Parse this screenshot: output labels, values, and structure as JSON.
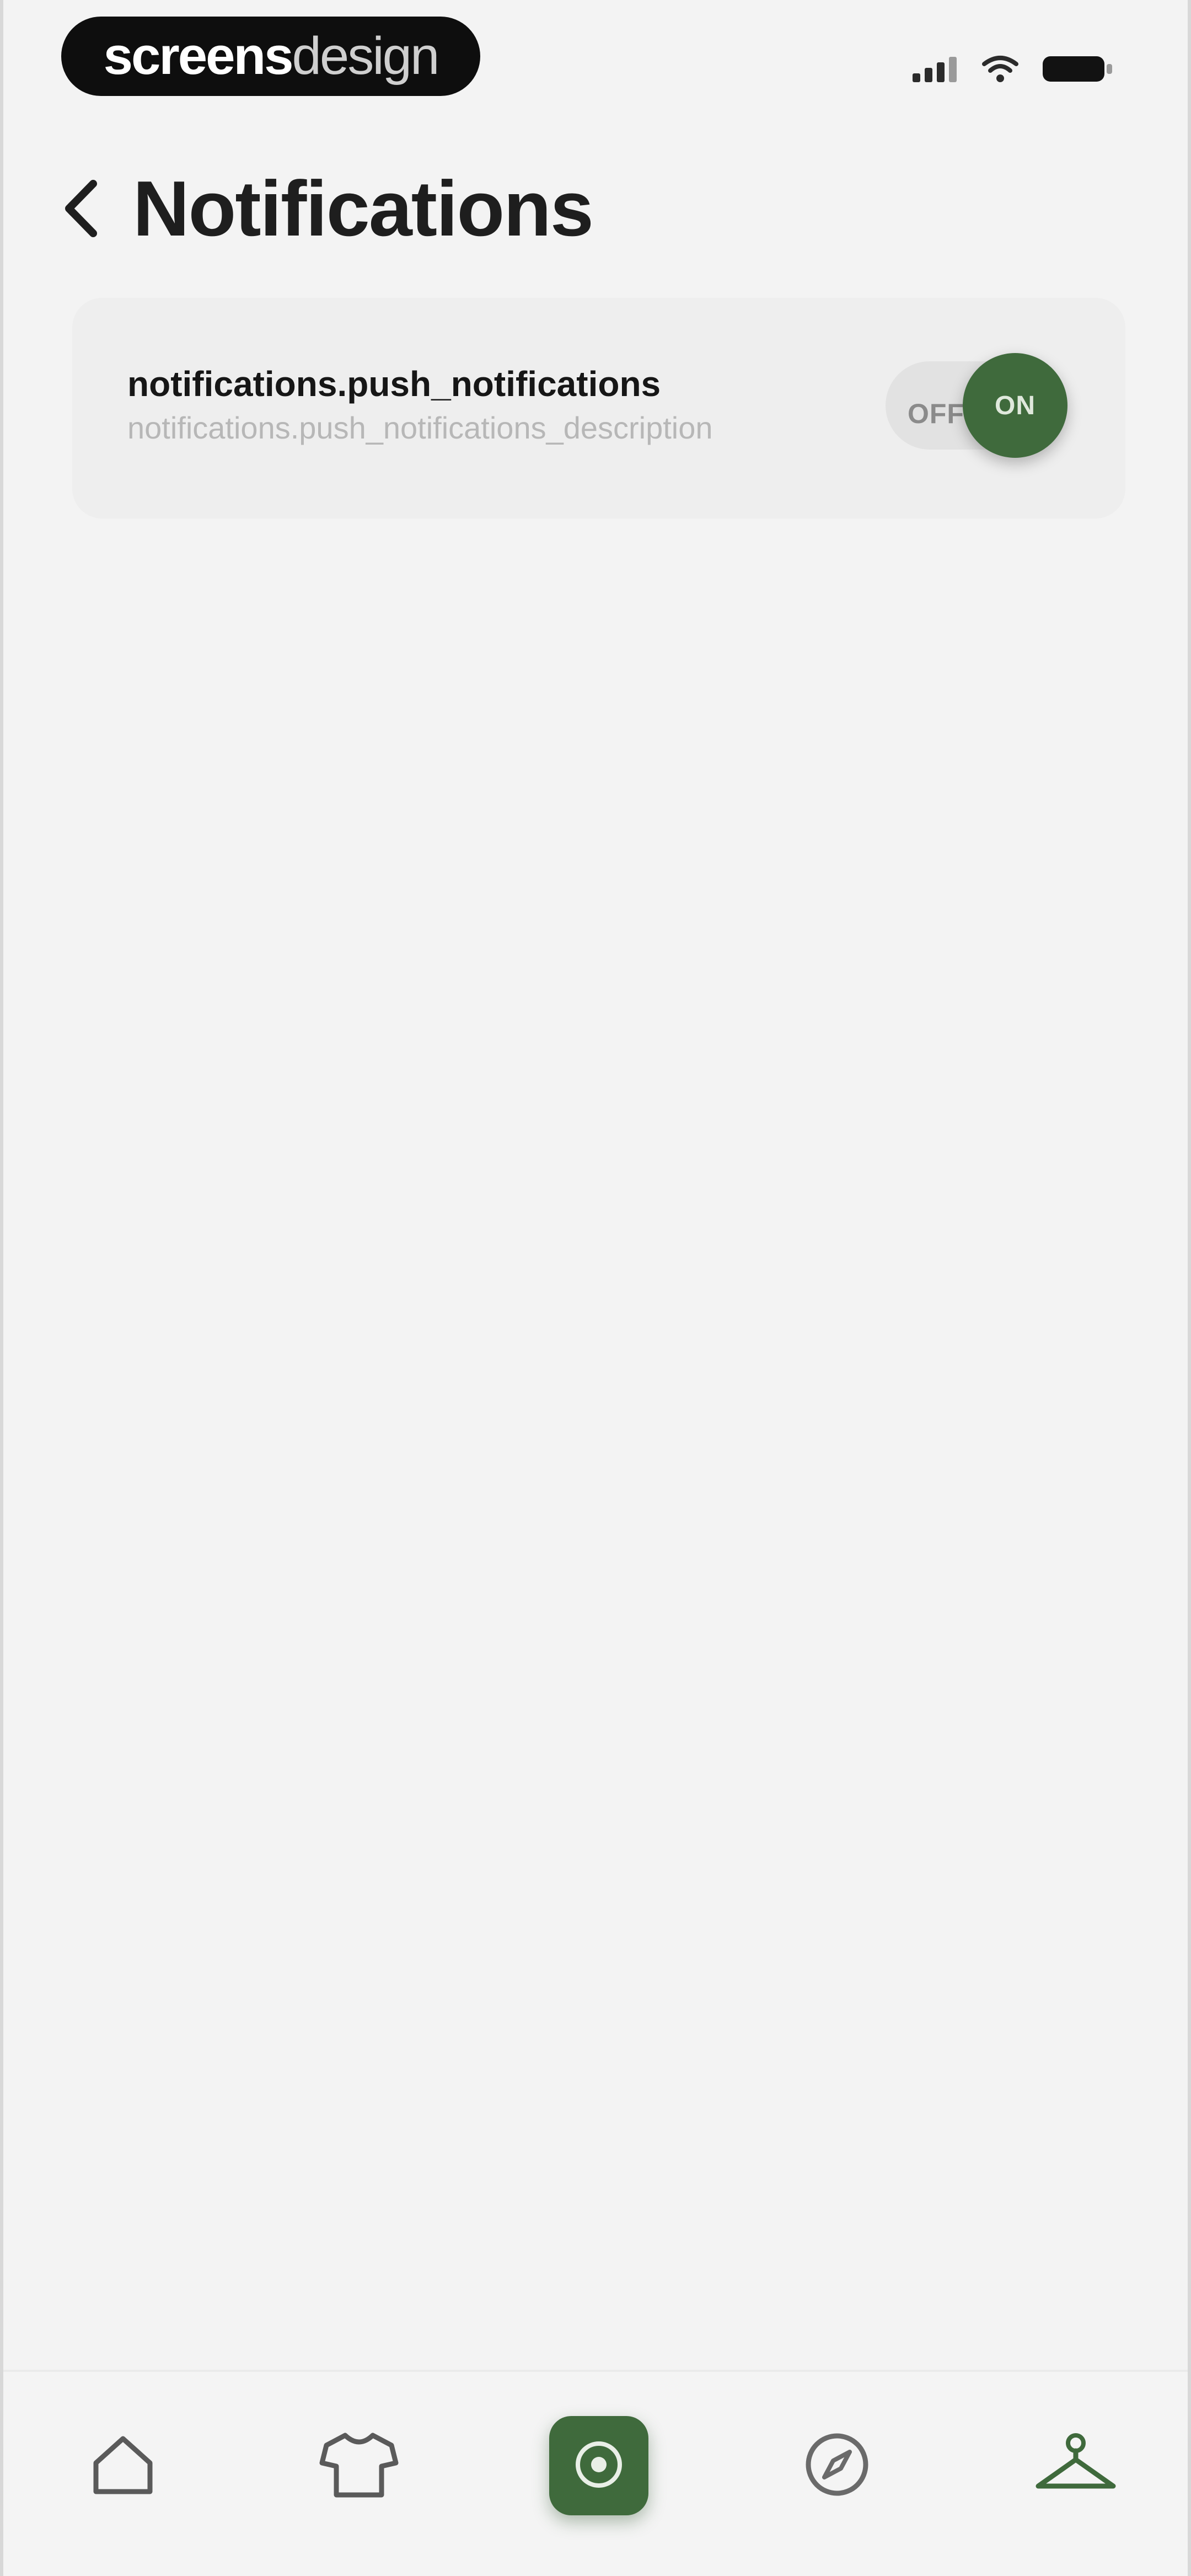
{
  "brand": {
    "part_a": "screens",
    "part_b": "design"
  },
  "status_bar": {
    "icons": [
      "signal-icon",
      "wifi-icon",
      "battery-icon"
    ]
  },
  "header": {
    "title": "Notifications",
    "back_icon": "chevron-left-icon"
  },
  "settings": [
    {
      "title": "notifications.push_notifications",
      "description": "notifications.push_notifications_description",
      "toggle": {
        "off_label": "OFF",
        "on_label": "ON",
        "state": "on"
      }
    }
  ],
  "bottom_nav": {
    "items": [
      {
        "icon": "home-icon"
      },
      {
        "icon": "shirt-icon"
      },
      {
        "icon": "add-circle-icon",
        "active": true
      },
      {
        "icon": "compass-icon"
      },
      {
        "icon": "hanger-icon"
      }
    ]
  },
  "colors": {
    "accent": "#3f6a3c",
    "background": "#f3f3f3",
    "card": "#eeeeee",
    "text_primary": "#1e1e1e",
    "text_secondary": "#b7b7b7"
  }
}
